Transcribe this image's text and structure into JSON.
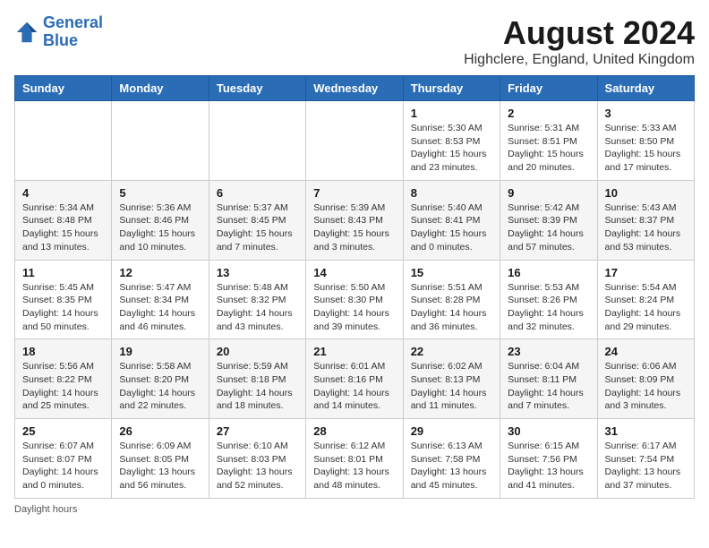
{
  "header": {
    "logo_line1": "General",
    "logo_line2": "Blue",
    "main_title": "August 2024",
    "subtitle": "Highclere, England, United Kingdom"
  },
  "days_of_week": [
    "Sunday",
    "Monday",
    "Tuesday",
    "Wednesday",
    "Thursday",
    "Friday",
    "Saturday"
  ],
  "weeks": [
    [
      {
        "day": "",
        "text": ""
      },
      {
        "day": "",
        "text": ""
      },
      {
        "day": "",
        "text": ""
      },
      {
        "day": "",
        "text": ""
      },
      {
        "day": "1",
        "text": "Sunrise: 5:30 AM\nSunset: 8:53 PM\nDaylight: 15 hours\nand 23 minutes."
      },
      {
        "day": "2",
        "text": "Sunrise: 5:31 AM\nSunset: 8:51 PM\nDaylight: 15 hours\nand 20 minutes."
      },
      {
        "day": "3",
        "text": "Sunrise: 5:33 AM\nSunset: 8:50 PM\nDaylight: 15 hours\nand 17 minutes."
      }
    ],
    [
      {
        "day": "4",
        "text": "Sunrise: 5:34 AM\nSunset: 8:48 PM\nDaylight: 15 hours\nand 13 minutes."
      },
      {
        "day": "5",
        "text": "Sunrise: 5:36 AM\nSunset: 8:46 PM\nDaylight: 15 hours\nand 10 minutes."
      },
      {
        "day": "6",
        "text": "Sunrise: 5:37 AM\nSunset: 8:45 PM\nDaylight: 15 hours\nand 7 minutes."
      },
      {
        "day": "7",
        "text": "Sunrise: 5:39 AM\nSunset: 8:43 PM\nDaylight: 15 hours\nand 3 minutes."
      },
      {
        "day": "8",
        "text": "Sunrise: 5:40 AM\nSunset: 8:41 PM\nDaylight: 15 hours\nand 0 minutes."
      },
      {
        "day": "9",
        "text": "Sunrise: 5:42 AM\nSunset: 8:39 PM\nDaylight: 14 hours\nand 57 minutes."
      },
      {
        "day": "10",
        "text": "Sunrise: 5:43 AM\nSunset: 8:37 PM\nDaylight: 14 hours\nand 53 minutes."
      }
    ],
    [
      {
        "day": "11",
        "text": "Sunrise: 5:45 AM\nSunset: 8:35 PM\nDaylight: 14 hours\nand 50 minutes."
      },
      {
        "day": "12",
        "text": "Sunrise: 5:47 AM\nSunset: 8:34 PM\nDaylight: 14 hours\nand 46 minutes."
      },
      {
        "day": "13",
        "text": "Sunrise: 5:48 AM\nSunset: 8:32 PM\nDaylight: 14 hours\nand 43 minutes."
      },
      {
        "day": "14",
        "text": "Sunrise: 5:50 AM\nSunset: 8:30 PM\nDaylight: 14 hours\nand 39 minutes."
      },
      {
        "day": "15",
        "text": "Sunrise: 5:51 AM\nSunset: 8:28 PM\nDaylight: 14 hours\nand 36 minutes."
      },
      {
        "day": "16",
        "text": "Sunrise: 5:53 AM\nSunset: 8:26 PM\nDaylight: 14 hours\nand 32 minutes."
      },
      {
        "day": "17",
        "text": "Sunrise: 5:54 AM\nSunset: 8:24 PM\nDaylight: 14 hours\nand 29 minutes."
      }
    ],
    [
      {
        "day": "18",
        "text": "Sunrise: 5:56 AM\nSunset: 8:22 PM\nDaylight: 14 hours\nand 25 minutes."
      },
      {
        "day": "19",
        "text": "Sunrise: 5:58 AM\nSunset: 8:20 PM\nDaylight: 14 hours\nand 22 minutes."
      },
      {
        "day": "20",
        "text": "Sunrise: 5:59 AM\nSunset: 8:18 PM\nDaylight: 14 hours\nand 18 minutes."
      },
      {
        "day": "21",
        "text": "Sunrise: 6:01 AM\nSunset: 8:16 PM\nDaylight: 14 hours\nand 14 minutes."
      },
      {
        "day": "22",
        "text": "Sunrise: 6:02 AM\nSunset: 8:13 PM\nDaylight: 14 hours\nand 11 minutes."
      },
      {
        "day": "23",
        "text": "Sunrise: 6:04 AM\nSunset: 8:11 PM\nDaylight: 14 hours\nand 7 minutes."
      },
      {
        "day": "24",
        "text": "Sunrise: 6:06 AM\nSunset: 8:09 PM\nDaylight: 14 hours\nand 3 minutes."
      }
    ],
    [
      {
        "day": "25",
        "text": "Sunrise: 6:07 AM\nSunset: 8:07 PM\nDaylight: 14 hours\nand 0 minutes."
      },
      {
        "day": "26",
        "text": "Sunrise: 6:09 AM\nSunset: 8:05 PM\nDaylight: 13 hours\nand 56 minutes."
      },
      {
        "day": "27",
        "text": "Sunrise: 6:10 AM\nSunset: 8:03 PM\nDaylight: 13 hours\nand 52 minutes."
      },
      {
        "day": "28",
        "text": "Sunrise: 6:12 AM\nSunset: 8:01 PM\nDaylight: 13 hours\nand 48 minutes."
      },
      {
        "day": "29",
        "text": "Sunrise: 6:13 AM\nSunset: 7:58 PM\nDaylight: 13 hours\nand 45 minutes."
      },
      {
        "day": "30",
        "text": "Sunrise: 6:15 AM\nSunset: 7:56 PM\nDaylight: 13 hours\nand 41 minutes."
      },
      {
        "day": "31",
        "text": "Sunrise: 6:17 AM\nSunset: 7:54 PM\nDaylight: 13 hours\nand 37 minutes."
      }
    ]
  ],
  "footer": {
    "note": "Daylight hours"
  }
}
